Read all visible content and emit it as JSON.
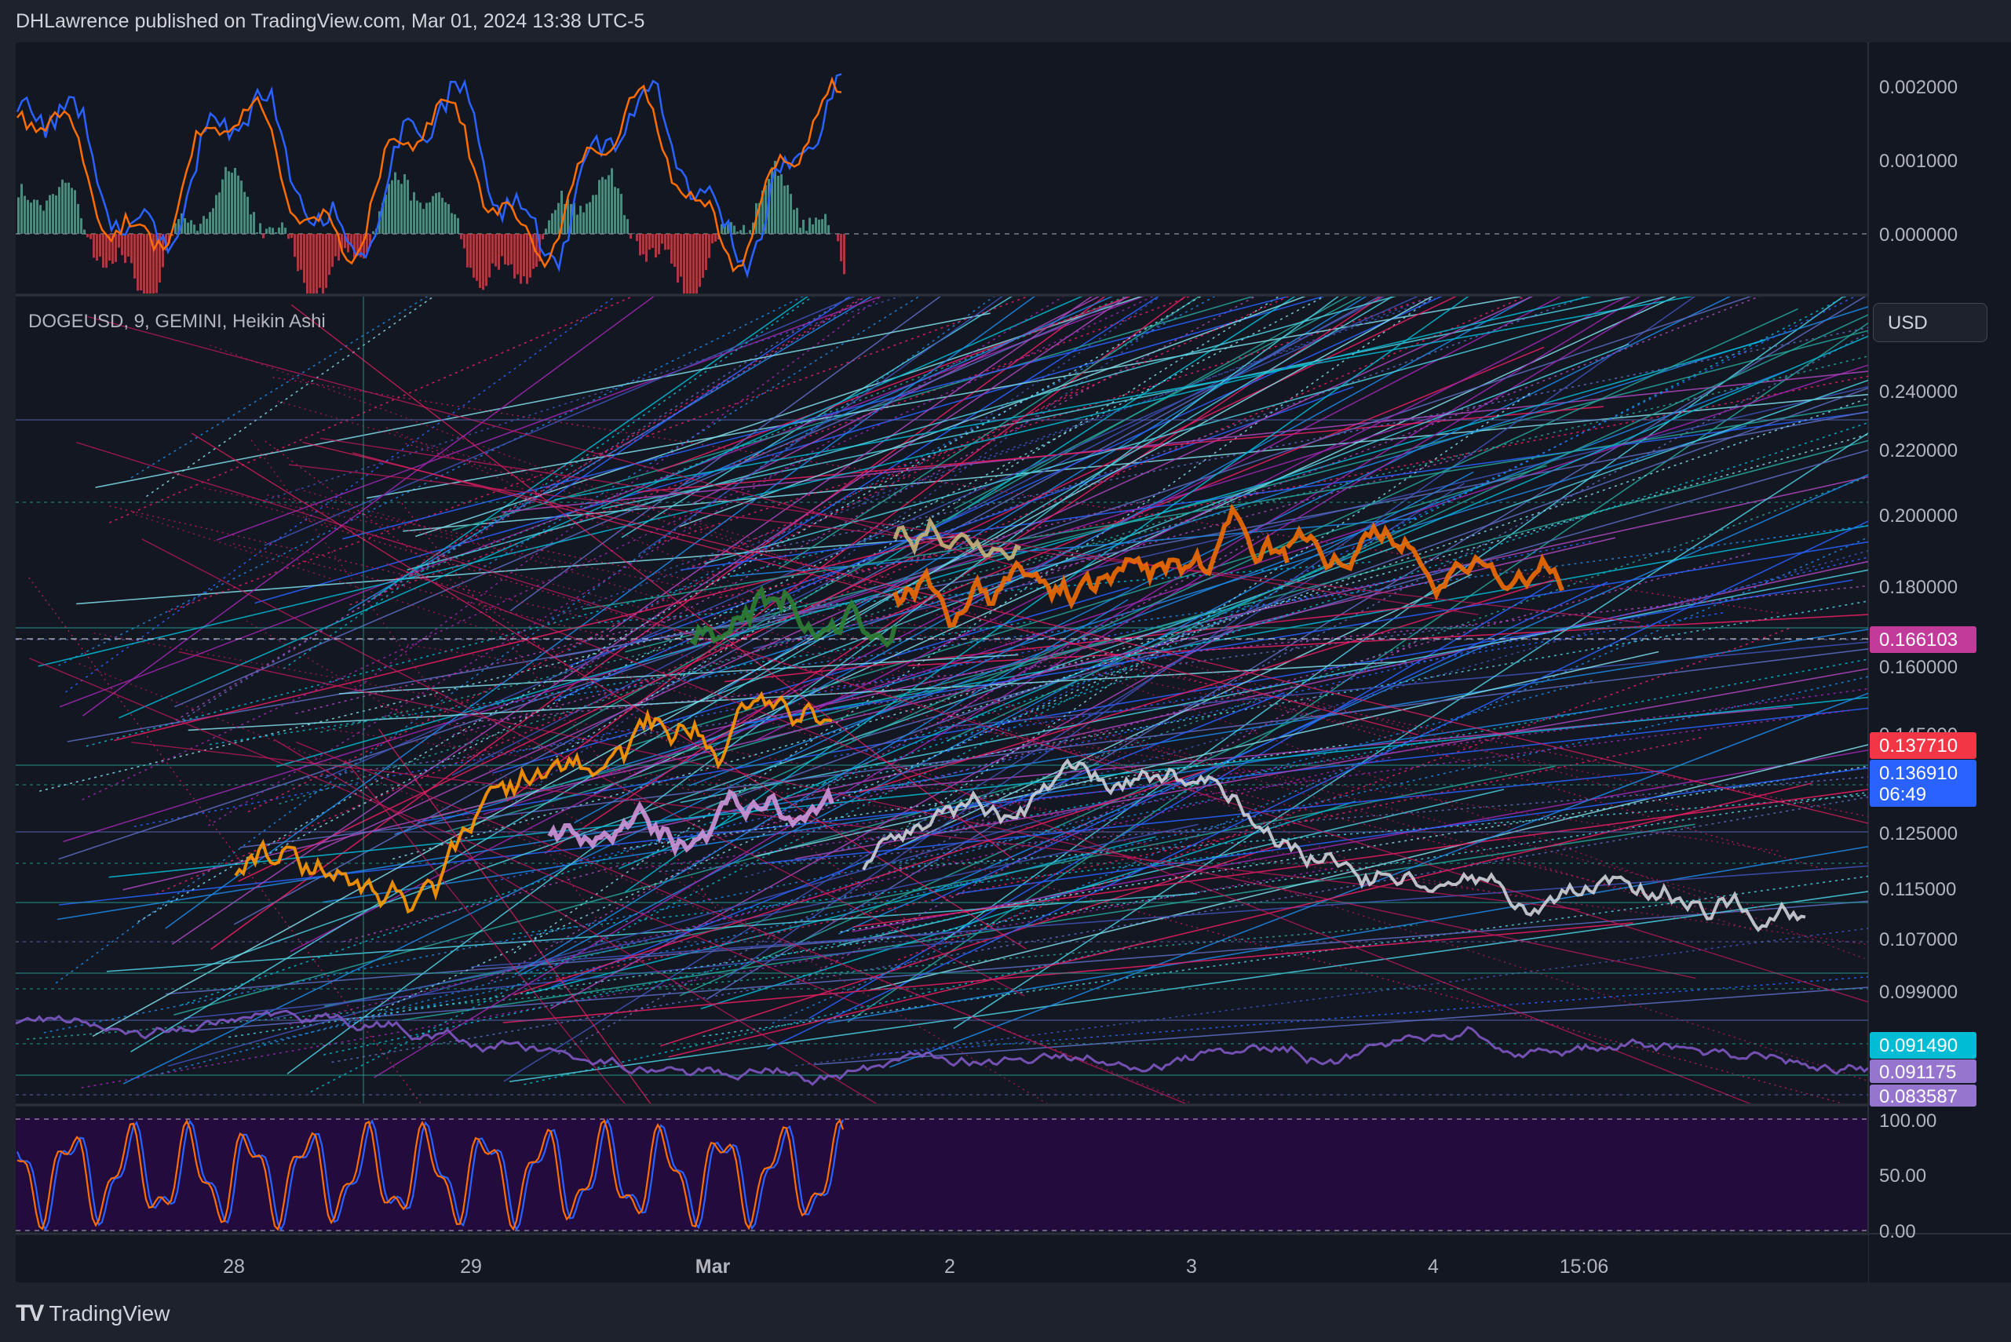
{
  "header": {
    "published_text": "DHLawrence published on TradingView.com, Mar 01, 2024 13:38 UTC-5"
  },
  "symbol": {
    "title": "DOGEUSD, 9, GEMINI, Heikin Ashi"
  },
  "currency_button": {
    "label": "USD"
  },
  "brand": {
    "name": "TradingView"
  },
  "colors": {
    "background": "#131722",
    "panel_border": "#2a2e39",
    "badge_pink": "#c23b9b",
    "badge_red": "#f23645",
    "badge_blue": "#2962ff",
    "badge_cyan": "#00bcd4",
    "badge_purple": "#9575cd"
  },
  "oscillator_axis": {
    "ticks": [
      "0.002000",
      "0.001000",
      "0.000000"
    ]
  },
  "price_axis": {
    "ticks": [
      "0.240000",
      "0.220000",
      "0.200000",
      "0.180000",
      "0.160000",
      "0.145000",
      "0.125000",
      "0.115000",
      "0.107000",
      "0.099000"
    ]
  },
  "price_badges": [
    {
      "name": "badge-166103",
      "value": "0.166103",
      "color": "#c23b9b"
    },
    {
      "name": "badge-137710",
      "value": "0.137710",
      "color": "#f23645"
    },
    {
      "name": "badge-136910",
      "value": "0.136910",
      "sub": "06:49",
      "color": "#2962ff"
    },
    {
      "name": "badge-091490",
      "value": "0.091490",
      "color": "#00bcd4"
    },
    {
      "name": "badge-091175",
      "value": "0.091175",
      "color": "#9575cd"
    },
    {
      "name": "badge-083587",
      "value": "0.083587",
      "color": "#9575cd"
    }
  ],
  "stoch_axis": {
    "ticks": [
      "100.00",
      "50.00",
      "0.00"
    ]
  },
  "time_axis": {
    "labels": [
      {
        "text": "28",
        "bold": false
      },
      {
        "text": "29",
        "bold": false
      },
      {
        "text": "Mar",
        "bold": true
      },
      {
        "text": "2",
        "bold": false
      },
      {
        "text": "3",
        "bold": false
      },
      {
        "text": "4",
        "bold": false
      },
      {
        "text": "15:06",
        "bold": false
      }
    ]
  }
}
